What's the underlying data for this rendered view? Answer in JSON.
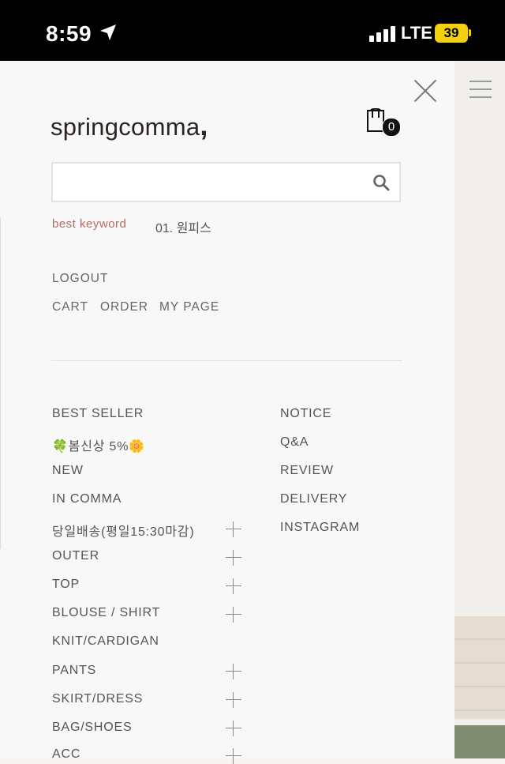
{
  "status_bar": {
    "time": "8:59",
    "network": "LTE",
    "battery": "39"
  },
  "brand": {
    "logo_text": "springcomma",
    "logo_mark": ","
  },
  "cart": {
    "count": "0"
  },
  "search": {
    "value": "",
    "placeholder": ""
  },
  "best_keyword": {
    "label": "best keyword",
    "item": "01. 원피스"
  },
  "account_links": {
    "logout": "LOGOUT",
    "cart": "CART",
    "order": "ORDER",
    "mypage": "MY PAGE"
  },
  "categories": [
    {
      "label": "BEST SELLER",
      "expandable": false
    },
    {
      "label": "🍀봄신상 5%🌼",
      "expandable": false
    },
    {
      "label": "NEW",
      "expandable": false
    },
    {
      "label": "IN COMMA",
      "expandable": false
    },
    {
      "label": "당일배송(평일15:30마감)",
      "expandable": true
    },
    {
      "label": "OUTER",
      "expandable": true
    },
    {
      "label": "TOP",
      "expandable": true
    },
    {
      "label": "BLOUSE / SHIRT",
      "expandable": true
    },
    {
      "label": "KNIT/CARDIGAN",
      "expandable": false
    },
    {
      "label": "PANTS",
      "expandable": true
    },
    {
      "label": "SKIRT/DRESS",
      "expandable": true
    },
    {
      "label": "BAG/SHOES",
      "expandable": true
    },
    {
      "label": "ACC",
      "expandable": true
    }
  ],
  "community": [
    "NOTICE",
    "Q&A",
    "REVIEW",
    "DELIVERY",
    "INSTAGRAM"
  ],
  "icons": {
    "close": "close-icon",
    "cart": "shopping-bag-icon",
    "search": "search-icon",
    "menu": "hamburger-icon",
    "location": "location-arrow-icon",
    "expand": "plus-icon"
  },
  "colors": {
    "accent": "#b56b63",
    "text": "#555555",
    "logo": "#2c2421"
  }
}
